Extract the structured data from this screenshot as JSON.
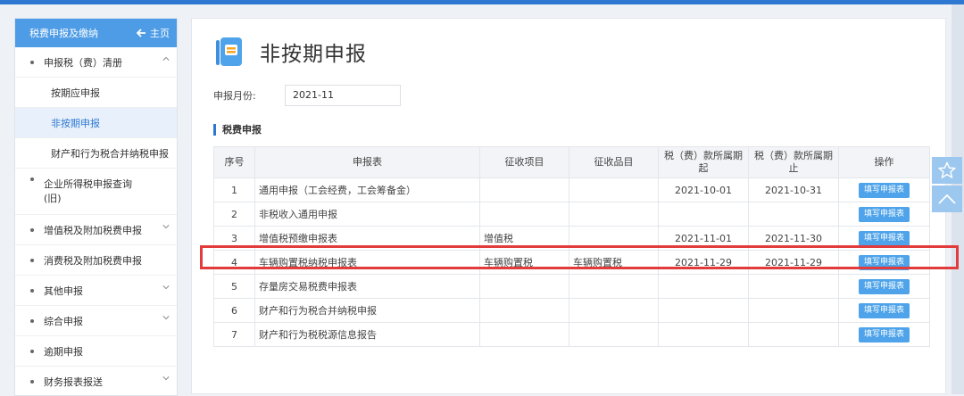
{
  "sidebar": {
    "header_title": "税费申报及缴纳",
    "home_label": "主页",
    "items": [
      {
        "label": "申报税（费）清册"
      },
      {
        "label": "按期应申报"
      },
      {
        "label": "非按期申报"
      },
      {
        "label": "财产和行为税合并纳税申报"
      },
      {
        "label": "企业所得税申报查询"
      },
      {
        "label": "(旧)"
      },
      {
        "label": "增值税及附加税费申报"
      },
      {
        "label": "消费税及附加税费申报"
      },
      {
        "label": "其他申报"
      },
      {
        "label": "综合申报"
      },
      {
        "label": "逾期申报"
      },
      {
        "label": "财务报表报送"
      }
    ]
  },
  "main": {
    "title": "非按期申报",
    "period_label": "申报月份:",
    "period_value": "2021-11",
    "section_title": "税费申报"
  },
  "table": {
    "headers": [
      "序号",
      "申报表",
      "征收项目",
      "征收品目",
      "税（费）款所属期起",
      "税（费）款所属期止",
      "操作"
    ],
    "rows": [
      {
        "no": "1",
        "form": "通用申报（工会经费，工会筹备金）",
        "item": "",
        "subitem": "",
        "start": "2021-10-01",
        "end": "2021-10-31",
        "action": "填写申报表"
      },
      {
        "no": "2",
        "form": "非税收入通用申报",
        "item": "",
        "subitem": "",
        "start": "",
        "end": "",
        "action": "填写申报表"
      },
      {
        "no": "3",
        "form": "增值税预缴申报表",
        "item": "增值税",
        "subitem": "",
        "start": "2021-11-01",
        "end": "2021-11-30",
        "action": "填写申报表"
      },
      {
        "no": "4",
        "form": "车辆购置税纳税申报表",
        "item": "车辆购置税",
        "subitem": "车辆购置税",
        "start": "2021-11-29",
        "end": "2021-11-29",
        "action": "填写申报表"
      },
      {
        "no": "5",
        "form": "存量房交易税费申报表",
        "item": "",
        "subitem": "",
        "start": "",
        "end": "",
        "action": "填写申报表"
      },
      {
        "no": "6",
        "form": "财产和行为税合并纳税申报",
        "item": "",
        "subitem": "",
        "start": "",
        "end": "",
        "action": "填写申报表"
      },
      {
        "no": "7",
        "form": "财产和行为税税源信息报告",
        "item": "",
        "subitem": "",
        "start": "",
        "end": "",
        "action": "填写申报表"
      }
    ]
  },
  "icons": {
    "home": "home-arrow-icon",
    "doc": "document-icon",
    "star": "star-icon",
    "up": "chevron-up-icon",
    "chevron": "chevron-down-icon"
  },
  "colors": {
    "accent": "#4e9ce6",
    "button": "#4ea3ea",
    "highlight": "#e23b3b"
  }
}
